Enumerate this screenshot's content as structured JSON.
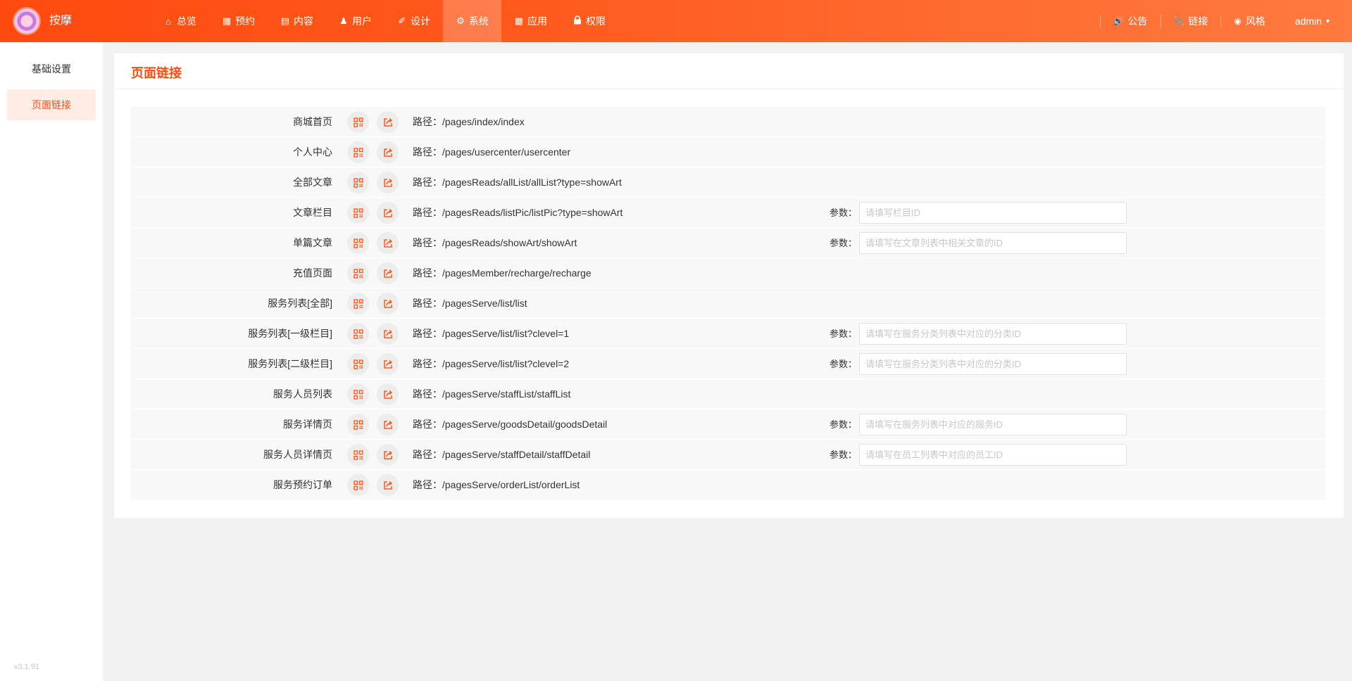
{
  "header": {
    "brand": "按摩",
    "nav": [
      {
        "label": "总览",
        "icon": "home-icon"
      },
      {
        "label": "预约",
        "icon": "calendar-icon"
      },
      {
        "label": "内容",
        "icon": "document-icon"
      },
      {
        "label": "用户",
        "icon": "user-icon"
      },
      {
        "label": "设计",
        "icon": "brush-icon"
      },
      {
        "label": "系统",
        "icon": "gear-icon",
        "active": true
      },
      {
        "label": "应用",
        "icon": "grid-icon"
      },
      {
        "label": "权限",
        "icon": "lock-icon"
      }
    ],
    "right": {
      "notice": "公告",
      "link": "链接",
      "style": "风格",
      "user": "admin"
    }
  },
  "sidebar": {
    "items": [
      {
        "label": "基础设置"
      },
      {
        "label": "页面链接",
        "active": true
      }
    ],
    "version": "v3.1.91"
  },
  "main": {
    "title": "页面链接",
    "param_label": "参数：",
    "rows": [
      {
        "name": "商城首页",
        "path": "路径：/pages/index/index"
      },
      {
        "name": "个人中心",
        "path": "路径：/pages/usercenter/usercenter"
      },
      {
        "name": "全部文章",
        "path": "路径：/pagesReads/allList/allList?type=showArt"
      },
      {
        "name": "文章栏目",
        "path": "路径：/pagesReads/listPic/listPic?type=showArt",
        "placeholder": "请填写栏目ID"
      },
      {
        "name": "单篇文章",
        "path": "路径：/pagesReads/showArt/showArt",
        "placeholder": "请填写在文章列表中相关文章的ID"
      },
      {
        "name": "充值页面",
        "path": "路径：/pagesMember/recharge/recharge"
      },
      {
        "name": "服务列表[全部]",
        "path": "路径：/pagesServe/list/list"
      },
      {
        "name": "服务列表[一级栏目]",
        "path": "路径：/pagesServe/list/list?clevel=1",
        "placeholder": "请填写在服务分类列表中对应的分类ID"
      },
      {
        "name": "服务列表[二级栏目]",
        "path": "路径：/pagesServe/list/list?clevel=2",
        "placeholder": "请填写在服务分类列表中对应的分类ID"
      },
      {
        "name": "服务人员列表",
        "path": "路径：/pagesServe/staffList/staffList"
      },
      {
        "name": "服务详情页",
        "path": "路径：/pagesServe/goodsDetail/goodsDetail",
        "placeholder": "请填写在服务列表中对应的服务ID"
      },
      {
        "name": "服务人员详情页",
        "path": "路径：/pagesServe/staffDetail/staffDetail",
        "placeholder": "请填写在员工列表中对应的员工ID"
      },
      {
        "name": "服务预约订单",
        "path": "路径：/pagesServe/orderList/orderList"
      }
    ]
  },
  "colors": {
    "accent": "#ff4a0f",
    "header_end": "#ff7a40",
    "active_bg": "#ffece5"
  }
}
